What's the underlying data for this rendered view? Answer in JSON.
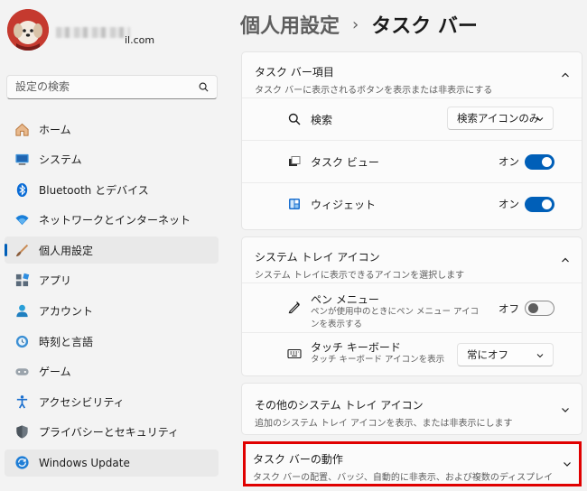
{
  "account": {
    "email_visible": "il.com"
  },
  "search": {
    "placeholder": "設定の検索"
  },
  "nav": [
    {
      "label": "ホーム",
      "icon": "home-icon"
    },
    {
      "label": "システム",
      "icon": "system-icon"
    },
    {
      "label": "Bluetooth とデバイス",
      "icon": "bluetooth-icon"
    },
    {
      "label": "ネットワークとインターネット",
      "icon": "network-icon"
    },
    {
      "label": "個人用設定",
      "icon": "brush-icon",
      "active": true
    },
    {
      "label": "アプリ",
      "icon": "apps-icon"
    },
    {
      "label": "アカウント",
      "icon": "account-icon"
    },
    {
      "label": "時刻と言語",
      "icon": "time-language-icon"
    },
    {
      "label": "ゲーム",
      "icon": "gamepad-icon"
    },
    {
      "label": "アクセシビリティ",
      "icon": "accessibility-icon"
    },
    {
      "label": "プライバシーとセキュリティ",
      "icon": "shield-icon"
    },
    {
      "label": "Windows Update",
      "icon": "update-icon"
    }
  ],
  "header": {
    "parent": "個人用設定",
    "separator": "›",
    "current": "タスク バー"
  },
  "taskbar_items": {
    "title": "タスク バー項目",
    "subtitle": "タスク バーに表示されるボタンを表示または非表示にする",
    "search": {
      "label": "検索",
      "value": "検索アイコンのみ"
    },
    "task_view": {
      "label": "タスク ビュー",
      "state": "オン",
      "on": true
    },
    "widgets": {
      "label": "ウィジェット",
      "state": "オン",
      "on": true
    }
  },
  "tray_icons": {
    "title": "システム トレイ アイコン",
    "subtitle": "システム トレイに表示できるアイコンを選択します",
    "pen_menu": {
      "label": "ペン メニュー",
      "description": "ペンが使用中のときにペン メニュー アイコンを表示する",
      "state": "オフ",
      "on": false
    },
    "touch_keyboard": {
      "label": "タッチ キーボード",
      "description": "タッチ キーボード アイコンを表示",
      "value": "常にオフ"
    }
  },
  "other_tray": {
    "title": "その他のシステム トレイ アイコン",
    "subtitle": "追加のシステム トレイ アイコンを表示、または非表示にします"
  },
  "behaviors": {
    "title": "タスク バーの動作",
    "subtitle": "タスク バーの配置、バッジ、自動的に非表示、および複数のディスプレイ"
  },
  "colors": {
    "accent": "#005fb8",
    "highlight_border": "#e00000"
  }
}
